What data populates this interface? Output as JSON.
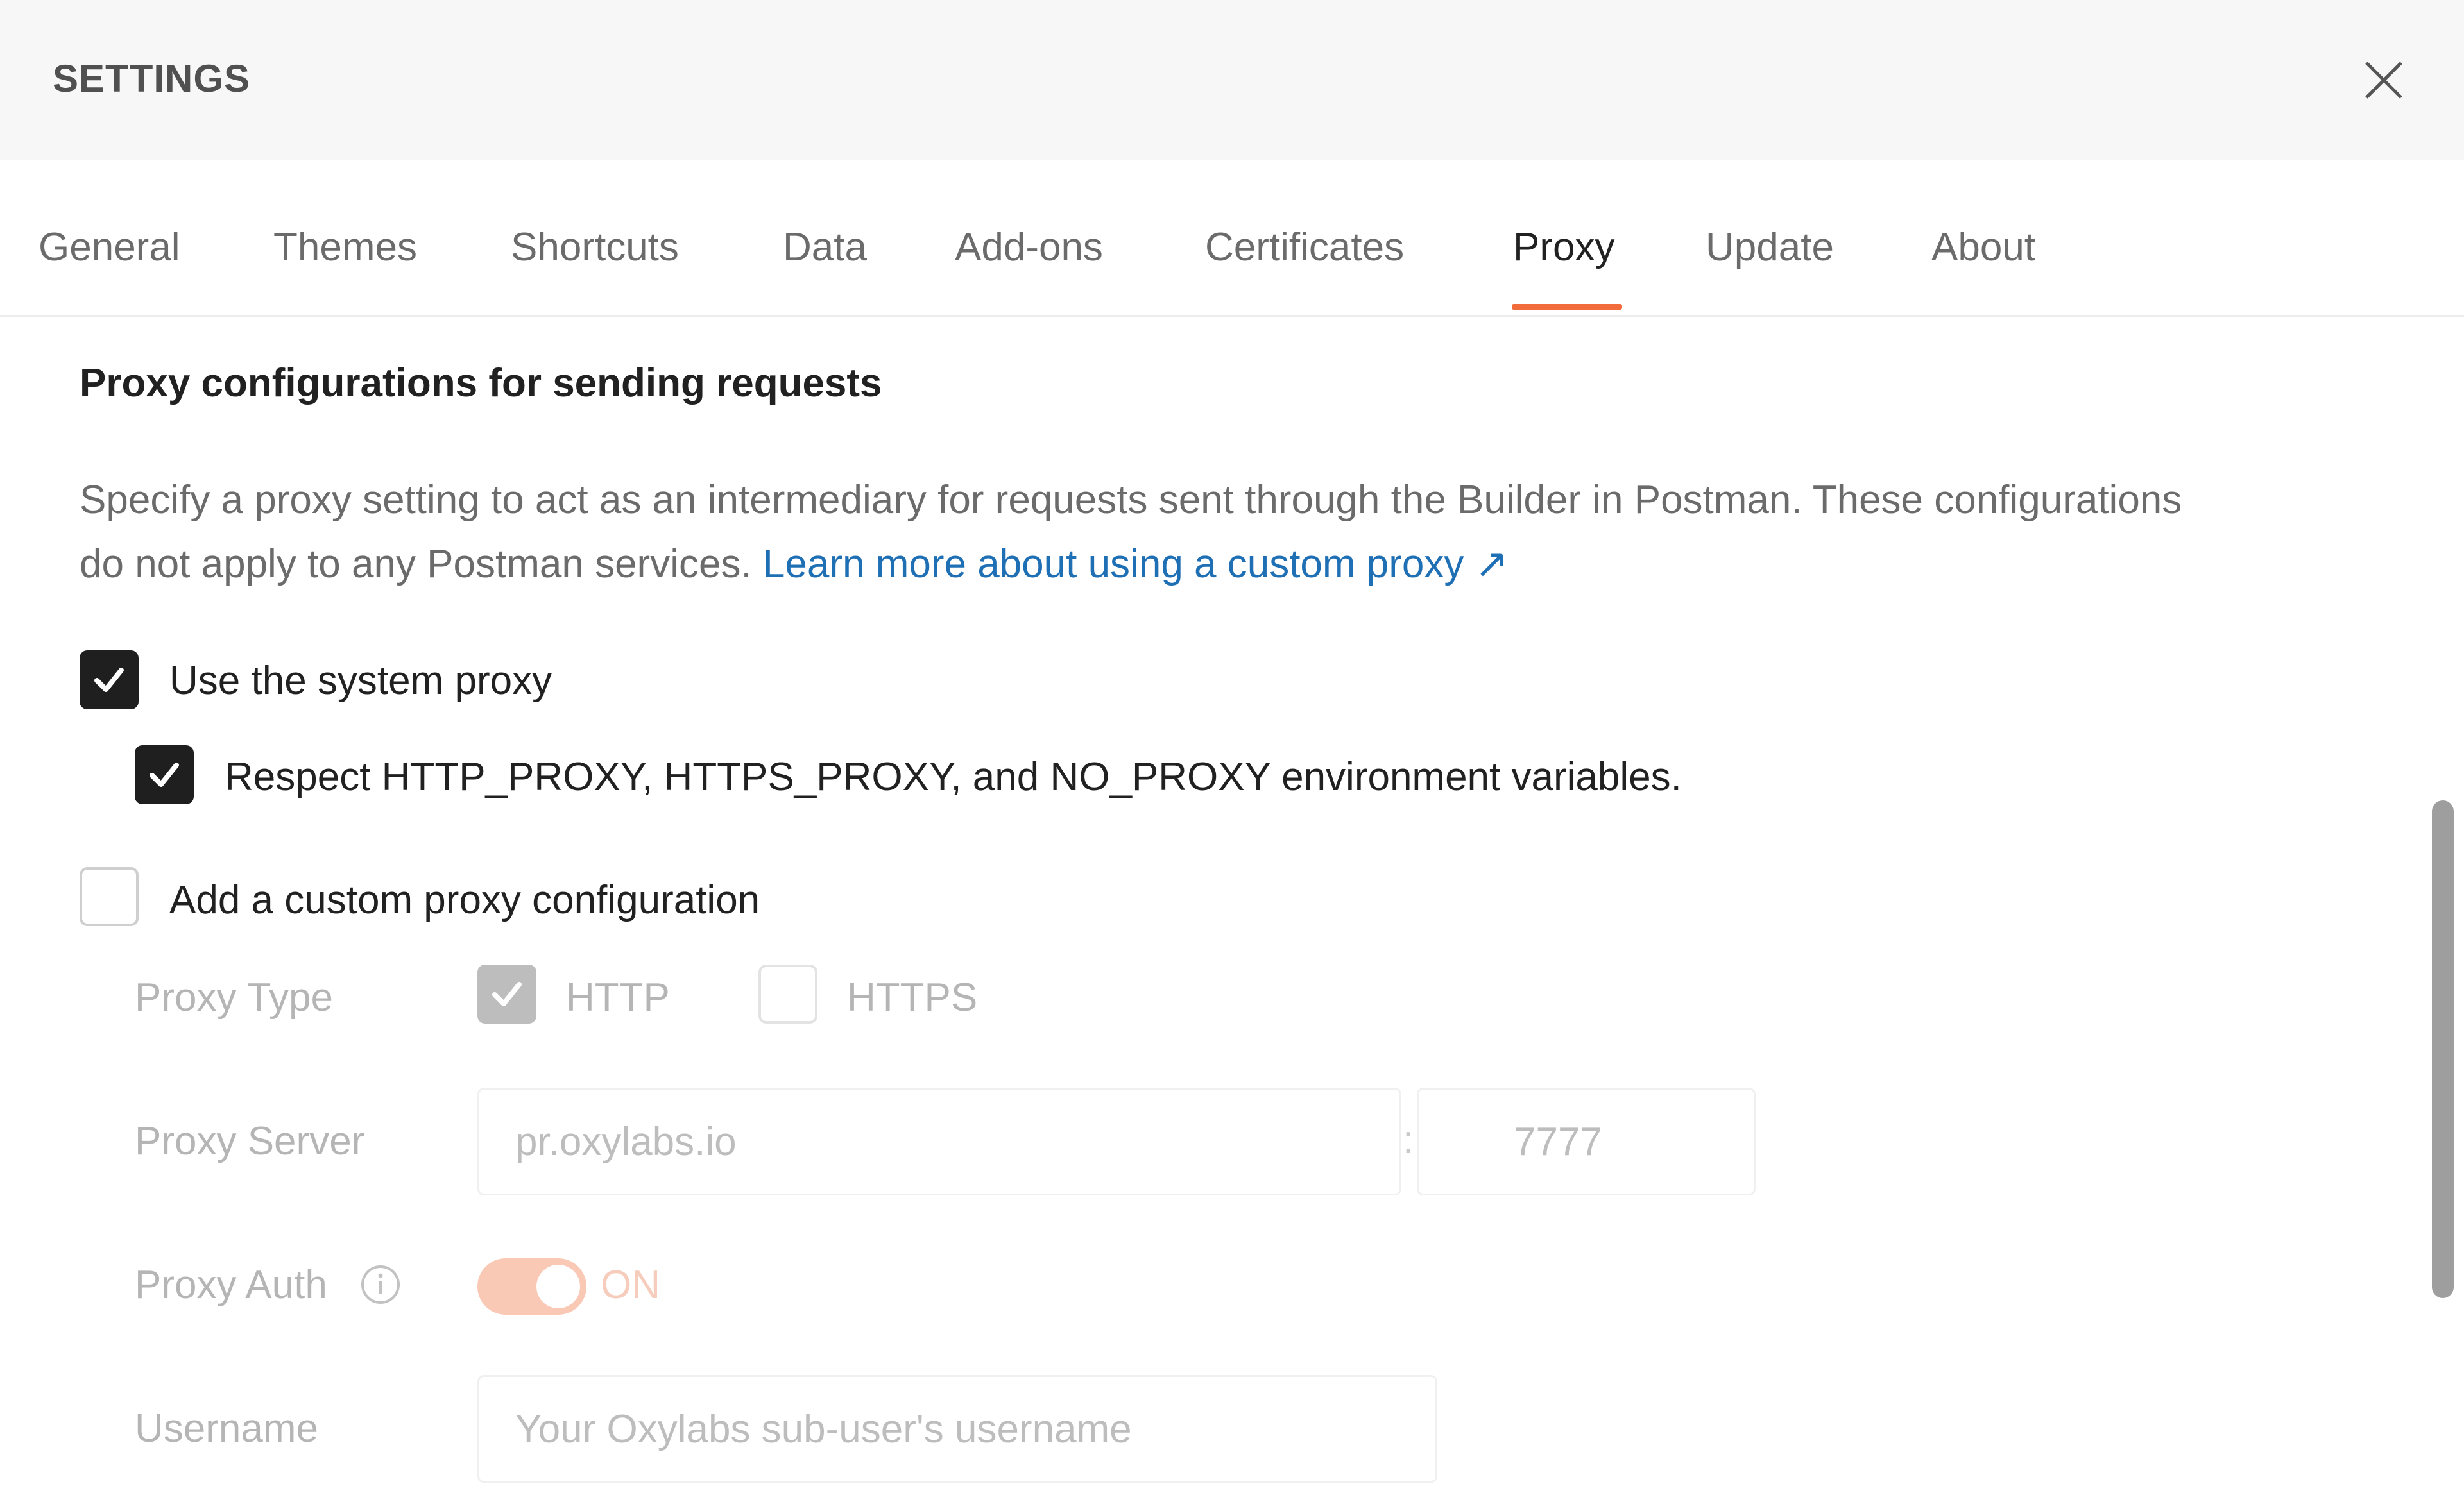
{
  "header": {
    "title": "SETTINGS"
  },
  "tabs": [
    {
      "label": "General"
    },
    {
      "label": "Themes"
    },
    {
      "label": "Shortcuts"
    },
    {
      "label": "Data"
    },
    {
      "label": "Add-ons"
    },
    {
      "label": "Certificates"
    },
    {
      "label": "Proxy",
      "active": true
    },
    {
      "label": "Update"
    },
    {
      "label": "About"
    }
  ],
  "proxy": {
    "section_title": "Proxy configurations for sending requests",
    "description": "Specify a proxy setting to act as an intermediary for requests sent through the Builder in Postman. These configurations do not apply to any Postman services.",
    "link_text": "Learn more about using a custom proxy ↗",
    "use_system_proxy": {
      "label": "Use the system proxy",
      "checked": true
    },
    "respect_env": {
      "label": "Respect HTTP_PROXY, HTTPS_PROXY, and NO_PROXY environment variables.",
      "checked": true
    },
    "custom_proxy": {
      "label": "Add a custom proxy configuration",
      "checked": false
    },
    "proxy_type": {
      "label": "Proxy Type",
      "http": {
        "label": "HTTP",
        "checked": true
      },
      "https": {
        "label": "HTTPS",
        "checked": false
      }
    },
    "proxy_server": {
      "label": "Proxy Server",
      "host_value": "pr.oxylabs.io",
      "separator": ":",
      "port_value": "7777"
    },
    "proxy_auth": {
      "label": "Proxy Auth",
      "toggle_label": "ON",
      "enabled": true
    },
    "username": {
      "label": "Username",
      "placeholder": "Your Oxylabs sub-user's username"
    }
  },
  "colors": {
    "accent": "#f26b3a",
    "link": "#1f6fb5",
    "toggle_disabled": "#f9c9b5"
  }
}
